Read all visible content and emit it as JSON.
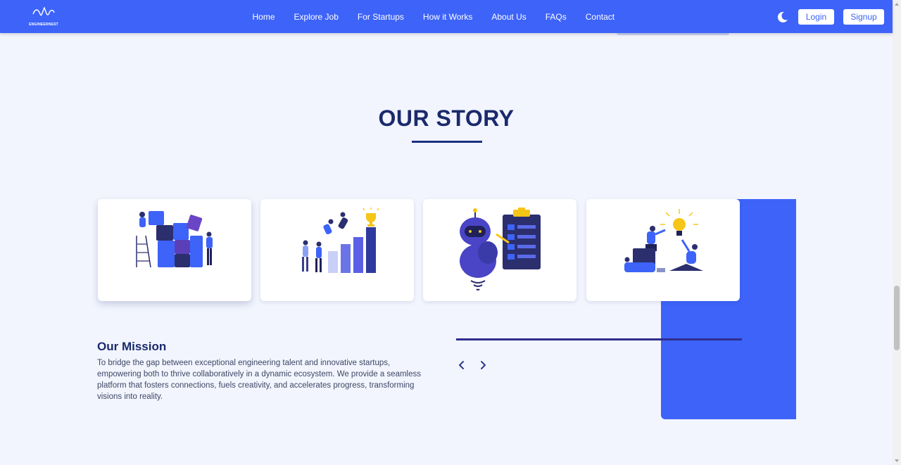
{
  "brand": {
    "name": "ENGINEERNEST"
  },
  "nav": {
    "links": [
      "Home",
      "Explore Job",
      "For Startups",
      "How it Works",
      "About Us",
      "FAQs",
      "Contact"
    ],
    "login_label": "Login",
    "signup_label": "Signup",
    "theme_icon": "moon-icon"
  },
  "story": {
    "title": "OUR STORY",
    "cards": [
      {
        "icon": "puzzle-teamwork-illustration"
      },
      {
        "icon": "growth-chart-trophy-illustration"
      },
      {
        "icon": "robot-checklist-illustration"
      },
      {
        "icon": "idea-lightbulb-illustration"
      }
    ]
  },
  "mission": {
    "heading": "Our Mission",
    "text": "To bridge the gap between exceptional engineering talent and innovative startups, empowering both to thrive collaboratively in a dynamic ecosystem. We provide a seamless platform that fosters connections, fuels creativity, and accelerates progress, transforming visions into reality."
  },
  "carousel": {
    "prev_icon": "chevron-left-icon",
    "next_icon": "chevron-right-icon"
  },
  "colors": {
    "primary": "#3d63f9",
    "navy": "#1a2a6c",
    "background": "#f2f5fd",
    "accent_yellow": "#f5c518"
  }
}
